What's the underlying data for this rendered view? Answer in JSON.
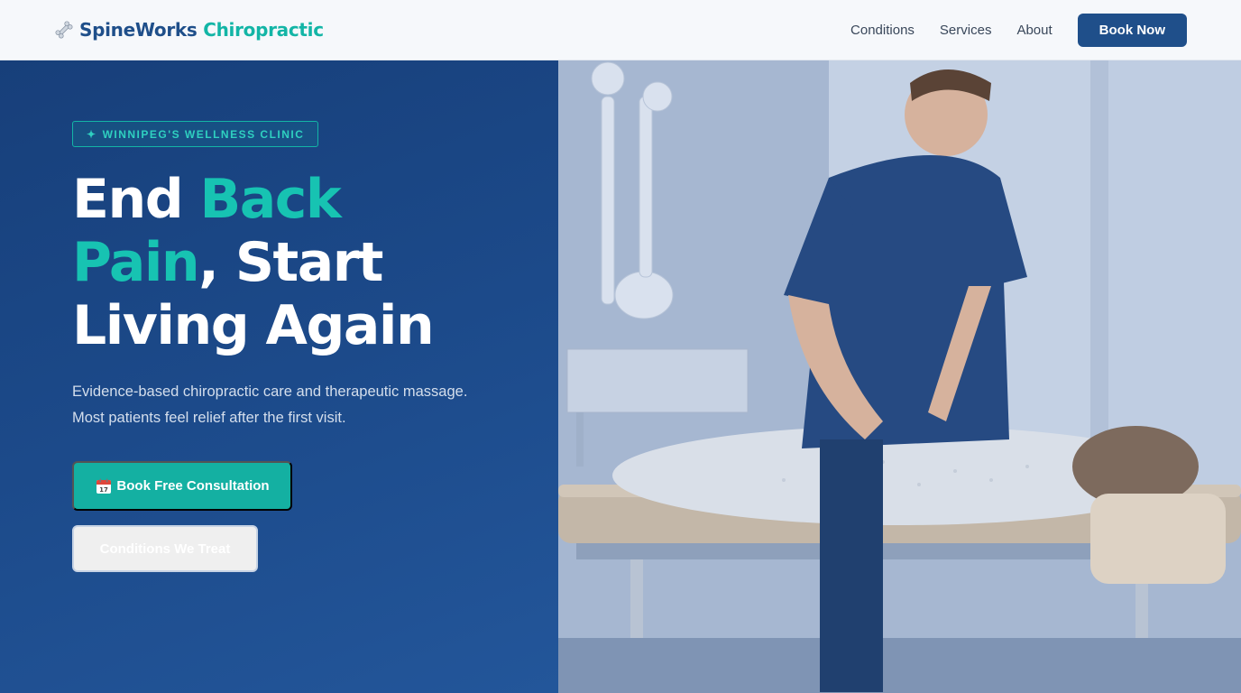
{
  "brand": {
    "name_part1": "SpineWorks",
    "name_part2": "Chiropractic",
    "icon": "bone-icon"
  },
  "nav": {
    "links": [
      "Conditions",
      "Services",
      "About"
    ],
    "book_now": "Book Now"
  },
  "hero": {
    "badge_icon": "✦",
    "badge": "WINNIPEG'S WELLNESS CLINIC",
    "headline": {
      "w1": "End ",
      "w2": "Back",
      "w3": "Pain",
      "w4": ", Start",
      "w5": "Living Again"
    },
    "sub_line1": "Evidence-based chiropractic care and therapeutic massage.",
    "sub_line2": "Most patients feel relief after the first visit.",
    "cta_primary": "Book Free Consultation",
    "cta_primary_icon": "calendar-icon",
    "cta_secondary": "Conditions We Treat",
    "image": "chiropractor-treating-patient-photo"
  },
  "colors": {
    "brand_blue": "#1f4f8a",
    "accent_teal": "#13b5a6",
    "hero_bg": "#1c4a8a"
  }
}
